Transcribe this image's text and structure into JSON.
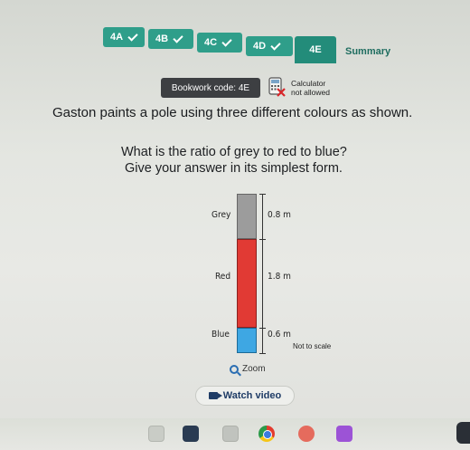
{
  "tabs": [
    {
      "label": "4A",
      "completed": true
    },
    {
      "label": "4B",
      "completed": true
    },
    {
      "label": "4C",
      "completed": true
    },
    {
      "label": "4D",
      "completed": true
    },
    {
      "label": "4E",
      "active": true
    },
    {
      "label": "Summary"
    }
  ],
  "bookwork": {
    "label": "Bookwork code: 4E"
  },
  "calculator": {
    "line1": "Calculator",
    "line2": "not allowed"
  },
  "question": {
    "main": "Gaston paints a pole using three different colours as shown.",
    "line2": "What is the ratio of grey to red to blue?",
    "line3": "Give your answer in its simplest form."
  },
  "diagram": {
    "segments": [
      {
        "name": "Grey",
        "length": "0.8 m",
        "color": "#9c9c9c"
      },
      {
        "name": "Red",
        "length": "1.8 m",
        "color": "#e13a34"
      },
      {
        "name": "Blue",
        "length": "0.6 m",
        "color": "#3ea7e3"
      }
    ],
    "note": "Not to scale"
  },
  "zoom": {
    "label": "Zoom"
  },
  "video": {
    "label": "Watch video"
  },
  "colors": {
    "accent": "#2f9e8a",
    "active_tab": "#238c7a",
    "bookwork_bg": "#3d3f42",
    "video_text": "#1f3c66"
  }
}
